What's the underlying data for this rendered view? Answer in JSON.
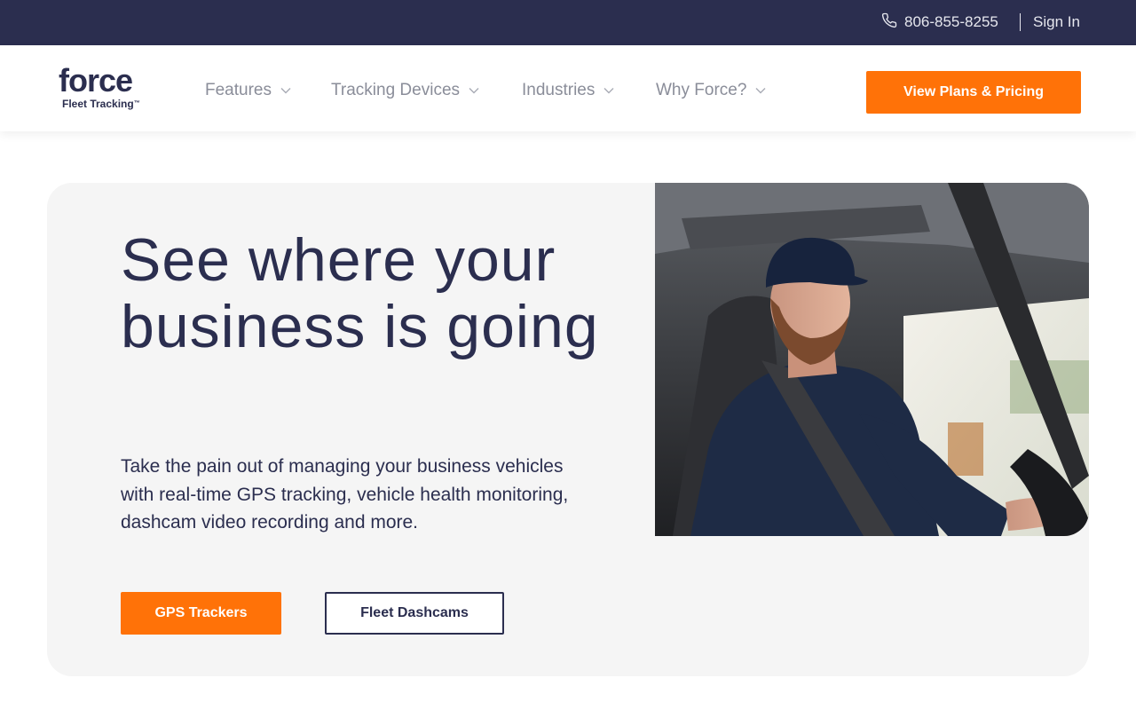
{
  "topbar": {
    "phone": "806-855-8255",
    "phone_icon": "phone-icon",
    "signin": "Sign In"
  },
  "header": {
    "logo": {
      "word": "force",
      "sub": "Fleet Tracking",
      "trademark": "™"
    },
    "nav": [
      {
        "label": "Features",
        "icon": "chevron-down-icon"
      },
      {
        "label": "Tracking Devices",
        "icon": "chevron-down-icon"
      },
      {
        "label": "Industries",
        "icon": "chevron-down-icon"
      },
      {
        "label": "Why Force?",
        "icon": "chevron-down-icon"
      }
    ],
    "cta_label": "View Plans & Pricing"
  },
  "hero": {
    "title": "See where your business is going",
    "description": "Take the pain out of managing your business vehicles with real-time GPS tracking, vehicle health monitoring, dashcam video recording and more.",
    "primary_button": "GPS Trackers",
    "secondary_button": "Fleet Dashcams"
  },
  "colors": {
    "navy": "#2b2e4f",
    "accent_orange": "#ff7208",
    "card_background": "#f5f5f5",
    "nav_text": "#8a8d99"
  }
}
